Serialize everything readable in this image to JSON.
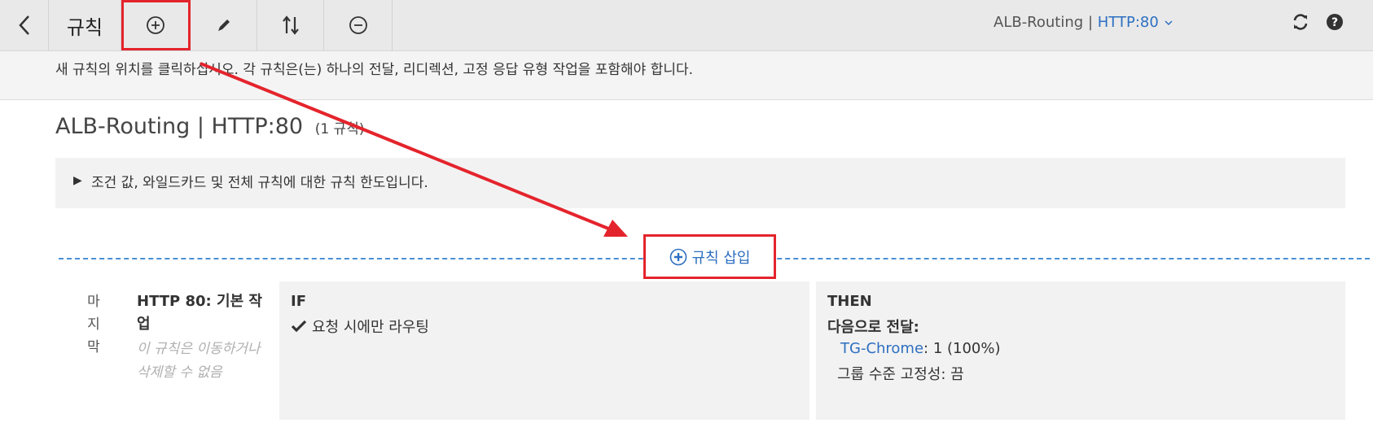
{
  "toolbar": {
    "title": "규칙",
    "lb_name": "ALB-Routing",
    "separator": "|",
    "listener": "HTTP:80",
    "buttons": {
      "back": "chevron-left-icon",
      "add": "plus-circle-icon",
      "edit": "pencil-icon",
      "reorder": "reorder-arrows-icon",
      "remove": "minus-circle-icon"
    },
    "refresh": "refresh-icon",
    "help": "help-icon"
  },
  "hint": "새 규칙의 위치를 클릭하십시오. 각 규칙은(는) 하나의 전달, 리디렉션, 고정 응답 유형 작업을 포함해야 합니다.",
  "heading": {
    "title": "ALB-Routing | HTTP:80",
    "count": "(1 규칙)"
  },
  "limits": {
    "text": "조건 값, 와일드카드 및 전체 규칙에 대한 규칙 한도입니다."
  },
  "insert": {
    "label": "규칙 삽입"
  },
  "rule": {
    "position": [
      "마",
      "지",
      "막"
    ],
    "name": "HTTP 80: 기본 작업",
    "note": "이 규칙은 이동하거나 삭제할 수 없음",
    "if_header": "IF",
    "if_condition": "요청 시에만 라우팅",
    "then_header": "THEN",
    "then_action": "다음으로 전달:",
    "target_group": "TG-Chrome",
    "target_detail": ": 1 (100%)",
    "stickiness": "그룹 수준 고정성: 끔"
  },
  "colors": {
    "highlight": "#e4242c",
    "link": "#2d6fc1",
    "dash": "#4a8fd4"
  }
}
